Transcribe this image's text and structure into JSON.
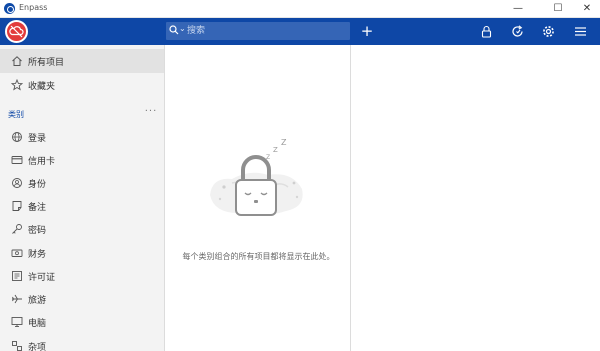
{
  "app": {
    "title": "Enpass"
  },
  "window_controls": {
    "minimize": "—",
    "maximize": "☐",
    "close": "✕"
  },
  "toolbar": {
    "search_placeholder": "搜索",
    "search_caret": "⌄",
    "add_label": "+",
    "accent_color": "#0e47a6",
    "logo_color": "#e23b3b"
  },
  "sidebar": {
    "top_items": [
      {
        "label": "所有项目",
        "icon": "home-icon",
        "active": true
      },
      {
        "label": "收藏夹",
        "icon": "star-icon",
        "active": false
      }
    ],
    "section_title": "类别",
    "more_label": "···",
    "categories": [
      {
        "label": "登录",
        "icon": "globe-icon"
      },
      {
        "label": "信用卡",
        "icon": "credit-card-icon"
      },
      {
        "label": "身份",
        "icon": "identity-icon"
      },
      {
        "label": "备注",
        "icon": "note-icon"
      },
      {
        "label": "密码",
        "icon": "key-icon"
      },
      {
        "label": "财务",
        "icon": "finance-icon"
      },
      {
        "label": "许可证",
        "icon": "license-icon"
      },
      {
        "label": "旅游",
        "icon": "plane-icon"
      },
      {
        "label": "电脑",
        "icon": "computer-icon"
      },
      {
        "label": "杂项",
        "icon": "misc-icon"
      }
    ]
  },
  "middle": {
    "empty_message": "每个类别组合的所有项目都将显示在此处。"
  }
}
